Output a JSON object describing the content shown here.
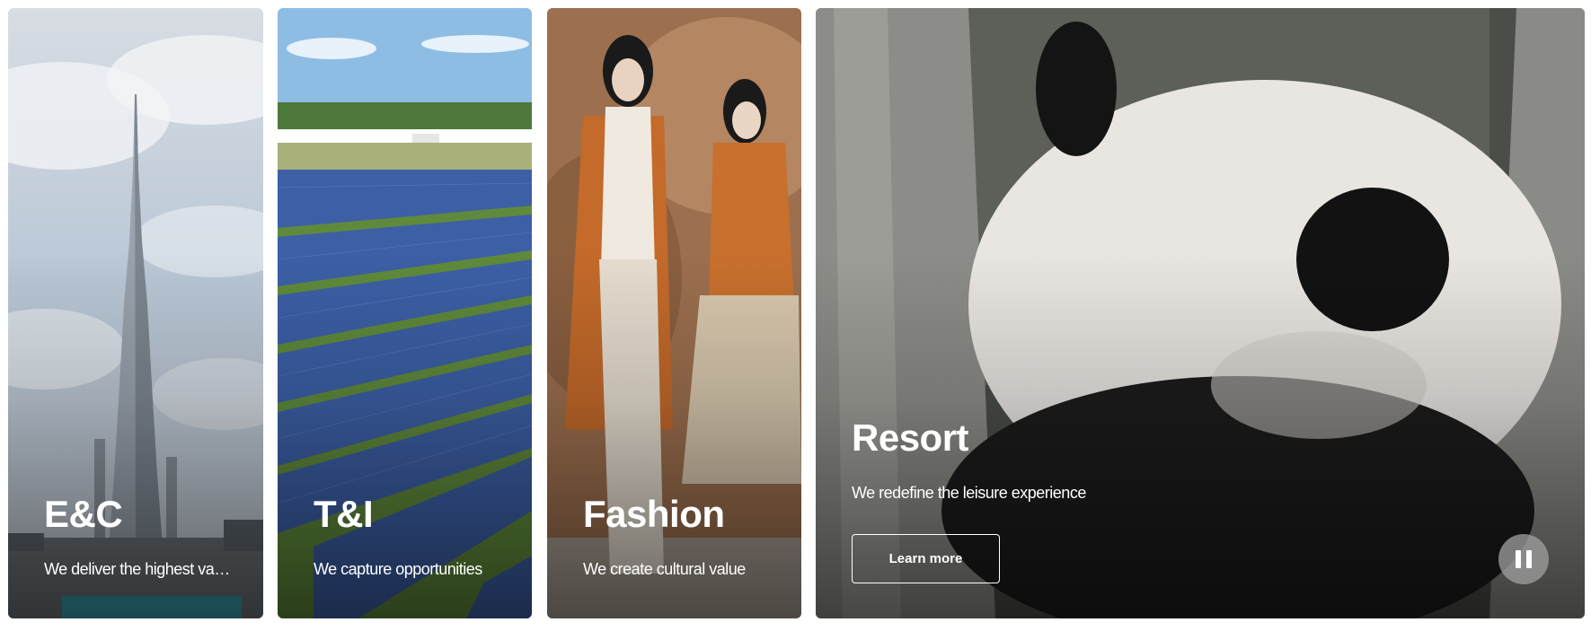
{
  "cards": [
    {
      "title": "E&C",
      "description": "We deliver the highest value",
      "image": "burj-khalifa-skyscraper-photo"
    },
    {
      "title": "T&I",
      "description": "We capture opportunities",
      "image": "solar-panel-field-photo"
    },
    {
      "title": "Fashion",
      "description": "We create cultural value",
      "image": "fashion-models-photo"
    },
    {
      "title": "Resort",
      "description": "We redefine the leisure experience",
      "button_label": "Learn more",
      "image": "giant-panda-video",
      "pause_icon": "pause-icon"
    }
  ],
  "colors": {
    "text": "#ffffff",
    "pause_button_bg": "#a0a0a0"
  }
}
